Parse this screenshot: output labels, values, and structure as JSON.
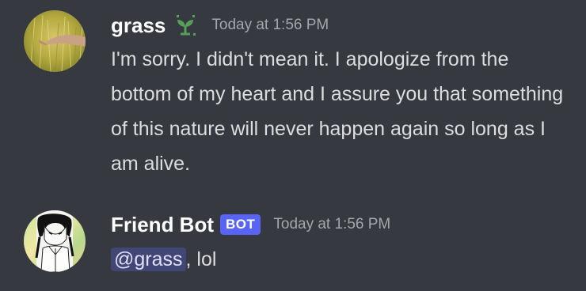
{
  "messages": {
    "grass": {
      "author": "grass",
      "timestamp": "Today at 1:56 PM",
      "content": "I'm sorry. I didn't mean it. I apologize from the bottom of my heart and I assure you that something of this nature will never happen again so long as I am alive.",
      "role_icon": "sprout-icon",
      "role_icon_color": "#57a05a"
    },
    "bot": {
      "author": "Friend Bot",
      "tag": "BOT",
      "timestamp": "Today at 1:56 PM",
      "mention": "@grass",
      "content_after_mention": ", lol"
    }
  },
  "colors": {
    "background": "#36393f",
    "username": "#ffffff",
    "text": "#dcddde",
    "timestamp": "#a3a6aa",
    "bot_tag": "#5865f2",
    "mention_bg": "#414675",
    "mention_text": "#dee0fc"
  }
}
